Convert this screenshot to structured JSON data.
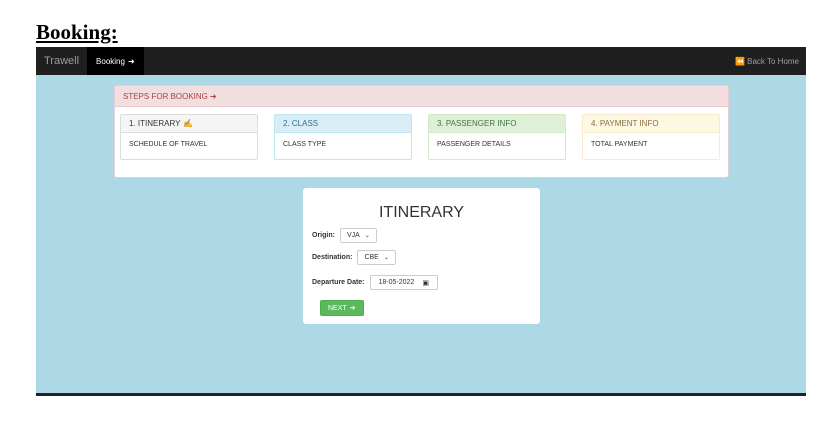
{
  "document": {
    "heading": "Booking:"
  },
  "navbar": {
    "brand": "Trawell",
    "active_item": "Booking",
    "active_icon": "➜",
    "right_icon": "⏪",
    "right_link": "Back To Home"
  },
  "steps": {
    "header": "STEPS FOR BOOKING",
    "header_icon": "➜",
    "items": [
      {
        "title": "1. ITINERARY",
        "icon": "✍",
        "body": "SCHEDULE OF TRAVEL"
      },
      {
        "title": "2. CLASS",
        "body": "CLASS TYPE"
      },
      {
        "title": "3. PASSENGER INFO",
        "body": "PASSENGER DETAILS"
      },
      {
        "title": "4. PAYMENT INFO",
        "body": "TOTAL PAYMENT"
      }
    ]
  },
  "itinerary": {
    "title": "ITINERARY",
    "origin_label": "Origin:",
    "origin_value": "VJA",
    "destination_label": "Destination:",
    "destination_value": "CBE",
    "date_label": "Departure Date:",
    "date_value": "18-05-2022",
    "next_label": "NEXT",
    "next_icon": "➜"
  },
  "icons": {
    "chevron": "⌄",
    "calendar": "▣"
  },
  "colors": {
    "content_bg": "#add8e6",
    "next_button": "#5cb85c",
    "navbar_bg": "#1f1f1f"
  }
}
